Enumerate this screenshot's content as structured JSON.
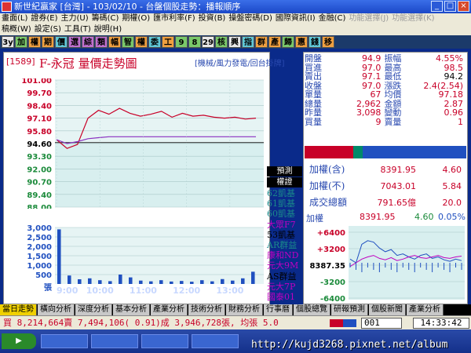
{
  "window": {
    "title": "新世紀贏家 [台灣] - 103/02/10 - 台盤個股走勢：播報順序"
  },
  "menu1": [
    "畫面(L)",
    "證券(E)",
    "主力(U)",
    "籌碼(C)",
    "期權(O)",
    "匯市利率(F)",
    "投資(B)",
    "操盤密碼(D)",
    "國際資訊(I)",
    "金融(C)",
    "功能選擇(J)",
    "功能選擇(K)"
  ],
  "menu2": [
    "稿概(W)",
    "設定(S)",
    "工具(T)",
    "說明(H)"
  ],
  "toolbar": [
    "3y",
    "加",
    "權",
    "期",
    "價",
    "選",
    "綜",
    "類",
    "幅",
    "智",
    "權",
    "委",
    "工",
    "9",
    "8",
    "29",
    "核",
    "興",
    "指",
    "群",
    "產",
    "歸",
    "惠",
    "錢",
    "移"
  ],
  "chart": {
    "code": "[1589]",
    "title": "F-永冠 量價走勢圖",
    "subtitle": "[機械/風力發電/回台掛牌]",
    "price_ticks": [
      "101.00",
      "99.70",
      "98.40",
      "97.10",
      "95.80",
      "94.60",
      "93.30",
      "92.00",
      "90.70",
      "89.40",
      "88.00"
    ],
    "vol_ticks": [
      "3,000",
      "2,500",
      "2,000",
      "1,500",
      "1,000",
      "500",
      "張"
    ],
    "time_ticks": [
      "9:00",
      "10:00",
      "11:00",
      "12:00",
      "13:00"
    ],
    "accent": "#c80028"
  },
  "chart_data": {
    "type": "line",
    "title": "F-永冠 量價走勢圖",
    "x_ticks": [
      "9:00",
      "10:00",
      "11:00",
      "12:00",
      "13:00"
    ],
    "ylim": [
      88.0,
      101.0
    ],
    "reference": 94.6,
    "series": [
      {
        "values": [
          94.9,
          94.0,
          94.4,
          97.1,
          97.9,
          97.5,
          98.1,
          97.6,
          97.3,
          97.5,
          97.8,
          97.2,
          97.6,
          97.3,
          97.4,
          97.2,
          97.1,
          97.2,
          97.0,
          97.1
        ]
      },
      {
        "values": [
          94.9,
          94.5,
          94.7,
          95.0,
          95.1,
          95.2,
          95.2,
          95.2,
          95.2,
          95.2,
          95.2,
          95.2,
          95.2,
          95.2,
          95.2,
          95.2,
          95.2,
          95.2,
          95.2,
          95.2
        ]
      }
    ],
    "volume": {
      "ylim": [
        0,
        3000
      ],
      "values": [
        2900,
        450,
        250,
        300,
        200,
        150,
        500,
        350,
        180,
        140,
        200,
        130,
        160,
        120,
        200,
        140,
        260,
        180,
        300,
        650
      ]
    }
  },
  "brokers": {
    "header1": "預測",
    "header2": "權證",
    "items": [
      "62凱基",
      "61凱基",
      "60凱基",
      "大眾F7",
      "53凱基",
      "AR群益",
      "康和ND",
      "元大9M",
      "AS群益",
      "元大7P",
      "國泰01",
      "....."
    ]
  },
  "quote": {
    "rows": [
      [
        "開盤",
        "94.9",
        "振幅",
        "4.55%"
      ],
      [
        "買進",
        "97.0",
        "最高",
        "98.5"
      ],
      [
        "賣出",
        "97.1",
        "最低",
        "94.2"
      ],
      [
        "收盤",
        "97.0",
        "漲跌",
        "2.4(2.54)"
      ],
      [
        "單量",
        "67",
        "均價",
        "97.18"
      ],
      [
        "總量",
        "2,962",
        "金額",
        "2.87"
      ],
      [
        "昨量",
        "3,098",
        "變動",
        "0.96"
      ],
      [
        "買量",
        "9",
        "賣量",
        "1"
      ]
    ]
  },
  "index": {
    "rows": [
      {
        "label": "加權(含)",
        "val": "8391.95",
        "chg": "4.60"
      },
      {
        "label": "加權(不)",
        "val": "7043.01",
        "chg": "5.84"
      },
      {
        "label": "成交總額",
        "val": "791.65億",
        "chg": "20.0"
      }
    ]
  },
  "mini": {
    "label": "加權",
    "value": "8391.95",
    "change": "4.60",
    "pct": "0.05%",
    "yticks": [
      "+6400",
      "+3200",
      "8387.35",
      "-3200",
      "-6400"
    ],
    "index_series": [
      0.45,
      0.5,
      0.25,
      0.2,
      0.22,
      0.3,
      0.35,
      0.32,
      0.4,
      0.38,
      0.42,
      0.45,
      0.4,
      0.38,
      0.44,
      0.42,
      0.46,
      0.48,
      0.45,
      0.47
    ],
    "purple_series": [
      0.55,
      0.5,
      0.45,
      0.42,
      0.4,
      0.44,
      0.46,
      0.43,
      0.47,
      0.45,
      0.42,
      0.4,
      0.43,
      0.44,
      0.42,
      0.4,
      0.43,
      0.44,
      0.42,
      0.41
    ]
  },
  "tabs": [
    "當日走勢",
    "橫向分析",
    "深度分析",
    "基本分析",
    "產業分析",
    "技術分析",
    "財務分析",
    "行事曆",
    "個股總覽",
    "研報預測",
    "個股新聞",
    "產業分析"
  ],
  "status": {
    "text": "買 8,214,664賣 7,494,106( 0.91)成 3,946,728張, 均張 5.0",
    "code": "001",
    "time": "14:33:42"
  },
  "watermark": "http://kujd3268.pixnet.net/album"
}
